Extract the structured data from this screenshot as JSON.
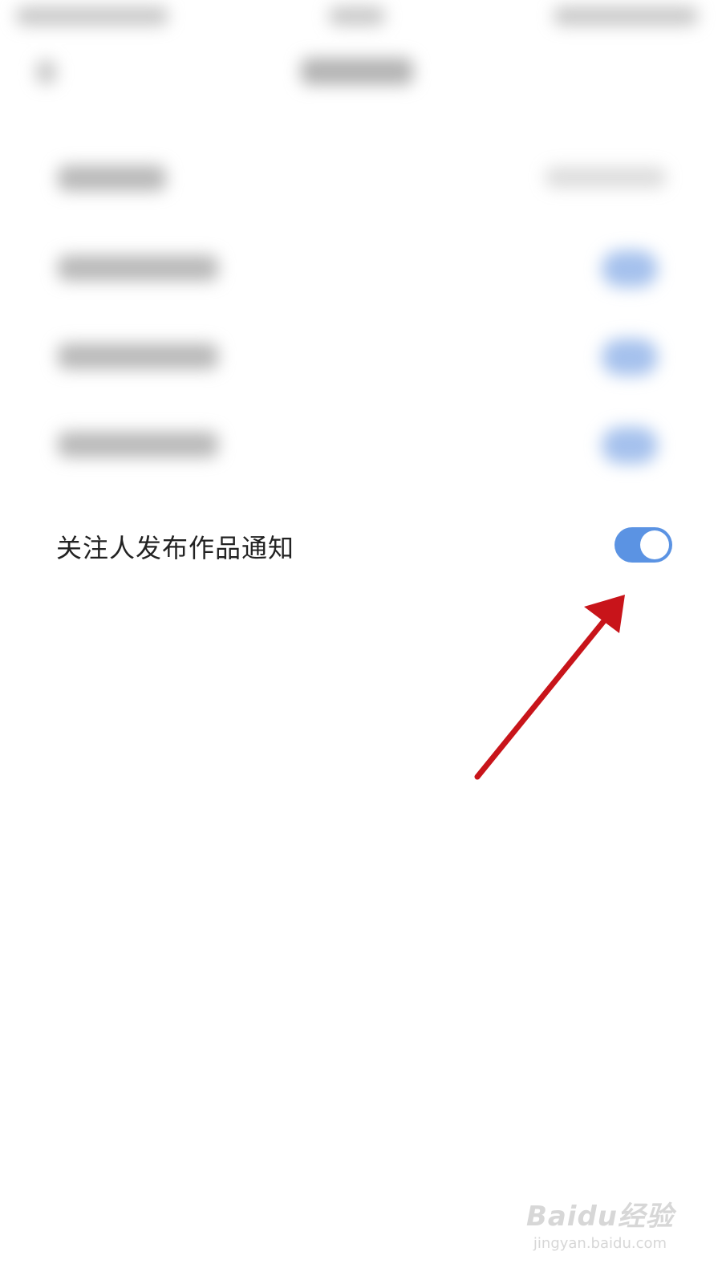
{
  "setting": {
    "label": "关注人发布作品通知",
    "enabled": true
  },
  "colors": {
    "toggle_on": "#5b93e3",
    "arrow": "#c8141a"
  },
  "watermark": {
    "logo": "Baidu经验",
    "url": "jingyan.baidu.com"
  }
}
